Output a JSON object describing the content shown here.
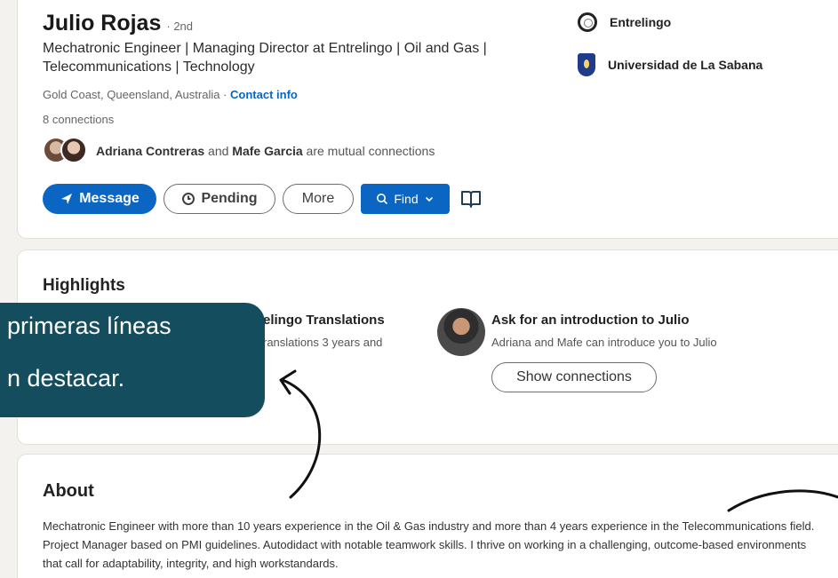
{
  "profile": {
    "name": "Julio Rojas",
    "degree": "· 2nd",
    "headline": "Mechatronic Engineer | Managing Director at Entrelingo | Oil and Gas | Telecommunications | Technology",
    "location": "Gold Coast, Queensland, Australia · ",
    "contact_info": "Contact info",
    "connections": "8 connections",
    "mutual": {
      "name1": "Adriana Contreras",
      "and": " and ",
      "name2": "Mafe Garcia",
      "suffix": " are mutual connections"
    }
  },
  "actions": {
    "message": "Message",
    "pending": "Pending",
    "more": "More",
    "find": "Find"
  },
  "organizations": [
    {
      "name": "Entrelingo"
    },
    {
      "name": "Universidad de La Sabana"
    }
  ],
  "highlights": {
    "title": "Highlights",
    "left_title": "elingo Translations",
    "left_desc": "ranslations 3 years and",
    "right_title": "Ask for an introduction to Julio",
    "right_desc": "Adriana and Mafe can introduce you to Julio",
    "show_connections": "Show connections"
  },
  "callout": {
    "line1": "primeras líneas",
    "line2": "n destacar."
  },
  "about": {
    "title": "About",
    "text": "Mechatronic Engineer with more than 10 years experience in the Oil & Gas industry and more than 4 years experience in the Telecommunications field. Project Manager based on PMI guidelines.  Autodidact with notable teamwork skills.  I thrive on working in a challenging, outcome-based environments that call for adaptability, integrity, and high workstandards."
  },
  "colors": {
    "primary": "#0a66c2",
    "callout": "#144d5d",
    "page_bg": "#f4f2ee"
  }
}
